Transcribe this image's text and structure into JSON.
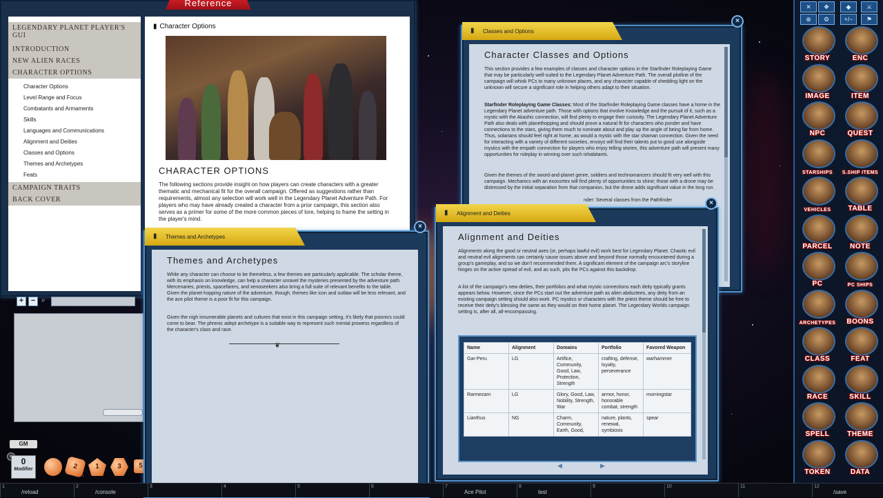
{
  "reference": {
    "banner": "Reference",
    "toc": {
      "heading_sections": [
        "LEGENDARY PLANET PLAYER'S GUI",
        "INTRODUCTION",
        "NEW ALIEN RACES",
        "CHARACTER OPTIONS"
      ],
      "subitems": [
        "Character Options",
        "Level Range and Focus",
        "Combatants and Armaments",
        "Skills",
        "Languages and Communications",
        "Alignment and Deities",
        "Classes and Options",
        "Themes and Archetypes",
        "Feats"
      ],
      "tail_sections": [
        "CAMPAIGN TRAITS",
        "BACK COVER"
      ]
    },
    "page_header": "Character Options",
    "page_heading": "CHARACTER OPTIONS",
    "page_body": "The following sections provide insight on how players can create characters with a greater thematic and mechanical fit for the overall campaign. Offered as suggestions rather than requirements, almost any selection will work well in the Legendary Planet Adventure Path. For players who may have already created a character from a prior campaign, this section also serves as a primer for some of the more common pieces of lore, helping to frame the setting in the player's mind."
  },
  "themes_window": {
    "tab": "Themes and Archetypes",
    "title": "Themes and Archetypes",
    "p1": "While any character can choose to be themeless, a few themes are particularly applicable. The scholar theme, with its emphasis on knowledge, can help a character unravel the mysteries presented by the adventure path. Mercenaries, priests, spacefarers, and xenoseekers also bring a full suite of relevant benefits to the table. Given the planet-hopping nature of the adventure, though, themes like icon and outlaw will be less relevant, and the ace pilot theme is a poor fit for this campaign.",
    "p2": "Given the nigh innumerable planets and cultures that exist in this campaign setting, it's likely that psionics could come to bear. The phrenic adept archetype is a suitable way to represent such mental prowess regardless of the character's class and race."
  },
  "classes_window": {
    "tab": "Classes and Options",
    "title": "Character Classes and Options",
    "p1": "This section provides a few examples of classes and character options in the Starfinder Roleplaying Game that may be particularly well-suited to the Legendary Planet Adventure Path. The overall plotline of the campaign will whisk PCs to many unknown places, and any character capable of shedding light on the unknown will secure a significant role in helping others adapt to their situation.",
    "p2_bold": "Starfinder Roleplaying Game Classes:",
    "p2": " Most of the Starfinder Roleplaying Game classes have a home in the Legendary Planet adventure path. Those with options that involve Knowledge and the pursuit of it, such as a mystic with the Akashic connection, will find plenty to engage their curiosity. The Legendary Planet Adventure Path also deals with planethopping and should prove a natural fit for characters who ponder and have connections to the stars, giving them much to ruminate about and play up the angle of being far from home. Thus, solarians should feel right at home, as would a mystic with the star shaman connection. Given the need for interacting with a variety of different societies, envoys will find their talents put to good use alongside mystics with the empath connection for players who enjoy telling stories, this adventure path will present many opportunities for roleplay in winning over such inhabitants.",
    "p3": "Given the themes of the sword-and-planet genre, soldiers and technomancers should fit very well with this campaign. Mechanics with an exocortex will find plenty of opportunities to shine; those with a drone may be distressed by the initial separation from that companion, but the drone adds significant value in the long run.",
    "p4_fragment": "nder: Several classes from the Pathfinder"
  },
  "alignment_window": {
    "tab": "Alignment and Deities",
    "title": "Alignment and Deities",
    "p1": "Alignments along the good or neutral axes (or, perhaps lawful evil) work best for Legendary Planet. Chaotic evil and neutral evil alignments can certainly cause issues above and beyond those normally encountered during a group's gameplay, and so we don't recommended them. A significant element of the campaign arc's storyline hinges on the active spread of evil, and as such, pits the PCs against this backdrop.",
    "p2": "A list of the campaign's new deities, their portfolios and what mystic connections each deity typically grants appears below. However, since the PCs start out the adventure path as alien abductees, any deity from an existing campaign setting should also work. PC mystics or characters with the priest theme should be free to receive their deity's blessing the same as they would on their home planet. The Legendary Worlds campaign setting is, after all, all-encompassing.",
    "table": {
      "headers": [
        "Name",
        "Alignment",
        "Domains",
        "Portfolio",
        "Favored Weapon"
      ],
      "rows": [
        [
          "Gar-Peru",
          "LG",
          "Artifice, Community, Good, Law, Protection, Strength",
          "crafting, defense, loyalty, perseverance",
          "warhammer"
        ],
        [
          "Rarmezarn",
          "LG",
          "Glory, Good, Law, Nobility, Strength, War",
          "armor, honor, honorable combat, strength",
          "morningstar"
        ],
        [
          "Lianthus",
          "NG",
          "Charm, Community, Earth, Good,",
          "nature, plants, renewal, symbiosis",
          "spear"
        ]
      ]
    }
  },
  "sidebar": {
    "tiles": [
      {
        "label": "STORY",
        "icon": "story-portrait"
      },
      {
        "label": "ENC",
        "icon": "encounter-portrait"
      },
      {
        "label": "IMAGE",
        "icon": "image-portrait"
      },
      {
        "label": "ITEM",
        "icon": "item-portrait"
      },
      {
        "label": "NPC",
        "icon": "npc-portrait"
      },
      {
        "label": "QUEST",
        "icon": "quest-portrait"
      },
      {
        "label": "STARSHIPS",
        "icon": "starships-portrait"
      },
      {
        "label": "S.SHIP ITEMS",
        "icon": "starship-items-portrait"
      },
      {
        "label": "VEHICLES",
        "icon": "vehicles-portrait"
      },
      {
        "label": "TABLE",
        "icon": "table-portrait"
      },
      {
        "label": "PARCEL",
        "icon": "parcel-portrait"
      },
      {
        "label": "NOTE",
        "icon": "note-portrait"
      },
      {
        "label": "PC",
        "icon": "pc-portrait"
      },
      {
        "label": "PC SHIPS",
        "icon": "pc-ships-portrait"
      },
      {
        "label": "ARCHETYPES",
        "icon": "archetypes-portrait"
      },
      {
        "label": "BOONS",
        "icon": "boons-portrait"
      },
      {
        "label": "CLASS",
        "icon": "class-portrait"
      },
      {
        "label": "FEAT",
        "icon": "feat-portrait"
      },
      {
        "label": "RACE",
        "icon": "race-portrait"
      },
      {
        "label": "SKILL",
        "icon": "skill-portrait"
      },
      {
        "label": "SPELL",
        "icon": "spell-portrait"
      },
      {
        "label": "THEME",
        "icon": "theme-portrait"
      },
      {
        "label": "TOKEN",
        "icon": "token-portrait"
      },
      {
        "label": "DATA",
        "icon": "data-portrait"
      }
    ],
    "top_buttons": [
      "✕",
      "❖",
      "◆",
      "⚔",
      "⊕",
      "⚙",
      "+/−",
      "⚑"
    ]
  },
  "chat": {
    "gm_badge": "GM",
    "modifier_value": "0",
    "modifier_label": "Modifier",
    "dice": [
      "",
      "2",
      "1",
      "3",
      "5"
    ]
  },
  "hotkeys": [
    {
      "n": "1",
      "t": "/reload"
    },
    {
      "n": "2",
      "t": "/console"
    },
    {
      "n": "3",
      "t": ""
    },
    {
      "n": "4",
      "t": ""
    },
    {
      "n": "5",
      "t": ""
    },
    {
      "n": "6",
      "t": ""
    },
    {
      "n": "7",
      "t": "Ace Pilot"
    },
    {
      "n": "8",
      "t": "test"
    },
    {
      "n": "9",
      "t": ""
    },
    {
      "n": "10",
      "t": ""
    },
    {
      "n": "11",
      "t": ""
    },
    {
      "n": "12",
      "t": "/save"
    }
  ],
  "colors": {
    "tab_yellow": "#e6c22a",
    "frame_blue": "#4f8fc6",
    "banner_red": "#d7202a",
    "sidebar_label_outline": "#7a0c0c"
  }
}
